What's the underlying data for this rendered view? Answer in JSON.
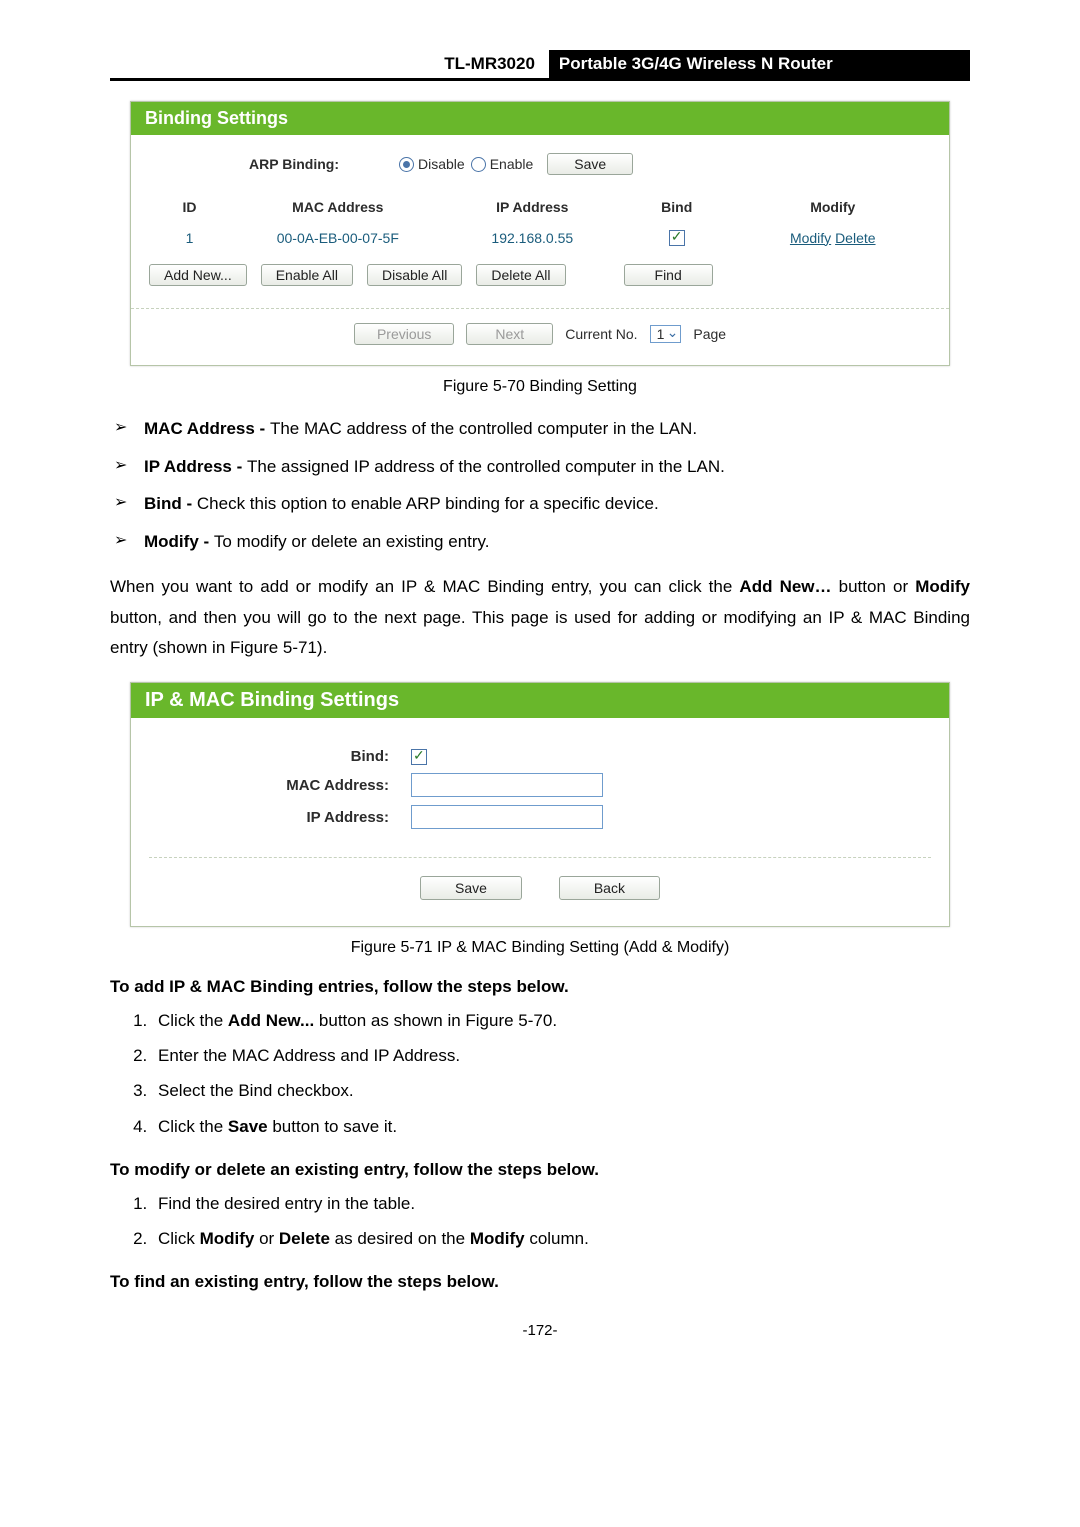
{
  "header": {
    "model": "TL-MR3020",
    "title": "Portable 3G/4G Wireless N Router"
  },
  "panel1": {
    "title": "Binding Settings",
    "arp_label": "ARP Binding:",
    "disable_label": "Disable",
    "enable_label": "Enable",
    "save_label": "Save",
    "cols": {
      "id": "ID",
      "mac": "MAC Address",
      "ip": "IP Address",
      "bind": "Bind",
      "modify": "Modify"
    },
    "row": {
      "id": "1",
      "mac": "00-0A-EB-00-07-5F",
      "ip": "192.168.0.55",
      "modify": "Modify",
      "delete": "Delete"
    },
    "buttons": {
      "add": "Add New...",
      "enable_all": "Enable All",
      "disable_all": "Disable All",
      "delete_all": "Delete All",
      "find": "Find"
    },
    "pager": {
      "prev": "Previous",
      "next": "Next",
      "current_label": "Current No.",
      "current_value": "1",
      "page_label": "Page"
    }
  },
  "caption1": "Figure 5-70 Binding Setting",
  "bullets": [
    {
      "bold": "MAC Address - ",
      "text": "The MAC address of the controlled computer in the LAN."
    },
    {
      "bold": "IP Address - ",
      "text": "The assigned IP address of the controlled computer in the LAN."
    },
    {
      "bold": "Bind - ",
      "text": "Check this option to enable ARP binding for a specific device."
    },
    {
      "bold": "Modify - ",
      "text": "To modify or delete an existing entry."
    }
  ],
  "para": {
    "pre": "When you want to add or modify an IP & MAC Binding entry, you can click the ",
    "b1": "Add New…",
    "mid": " button or ",
    "b2": "Modify",
    "post": " button, and then you will go to the next page. This page is used for adding or modifying an IP & MAC Binding entry (shown in Figure 5-71)."
  },
  "panel2": {
    "title": "IP & MAC Binding Settings",
    "bind_label": "Bind:",
    "mac_label": "MAC Address:",
    "ip_label": "IP Address:",
    "save": "Save",
    "back": "Back"
  },
  "caption2": "Figure 5-71    IP & MAC Binding Setting (Add & Modify)",
  "sec1_head": "To add IP & MAC Binding entries, follow the steps below.",
  "sec1_items": [
    {
      "pre": "Click the ",
      "b": "Add New...",
      "post": " button as shown in Figure 5-70."
    },
    {
      "pre": "Enter the MAC Address and IP Address.",
      "b": "",
      "post": ""
    },
    {
      "pre": "Select the Bind checkbox.",
      "b": "",
      "post": ""
    },
    {
      "pre": "Click the ",
      "b": "Save",
      "post": " button to save it."
    }
  ],
  "sec2_head": "To modify or delete an existing entry, follow the steps below.",
  "sec2_items": [
    {
      "pre": "Find the desired entry in the table.",
      "b": "",
      "post": ""
    },
    {
      "pre": "Click ",
      "b": "Modify",
      "mid": " or ",
      "b2": "Delete",
      "mid2": " as desired on the ",
      "b3": "Modify",
      "post": " column."
    }
  ],
  "sec3_head": "To find an existing entry, follow the steps below.",
  "page_number": "-172-"
}
